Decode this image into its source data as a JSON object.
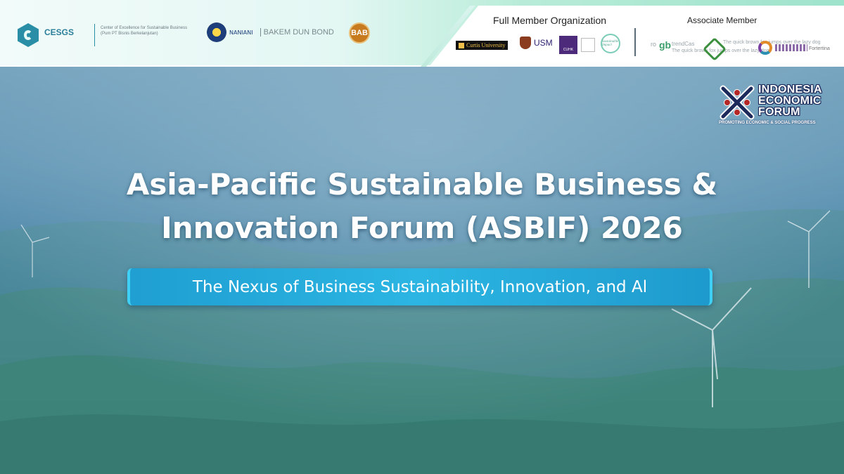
{
  "banner": {
    "cesgs": {
      "name": "CESGS",
      "description": "Center of Excellence for Sustainable Business (Pum PT Bisnis Berkelanjutan)"
    },
    "naniani": {
      "name": "NANIANI"
    },
    "bakem": {
      "name": "BAKEM DUN BOND"
    },
    "bab": {
      "mark": "BAB"
    },
    "full_member_title": "Full Member Organization",
    "associate_member_title": "Associate Member",
    "full_members": {
      "curtis": "Curtis University",
      "usm": "USM",
      "cuhk": "CUHK",
      "sustainable": "Sustainable Impact"
    },
    "associates": {
      "ro": "ro",
      "gb": "gb",
      "trendcas": "trendCas",
      "quick_line_1": "The quick brown fox jumps over the lazy dog",
      "quick_line_2": "The quick brown fox jumps over the lazy dog",
      "fortertina": "Fortertina"
    }
  },
  "ief": {
    "line1": "INDONESIA",
    "line2": "ECONOMIC",
    "line3": "FORUM",
    "tagline": "PROMOTING ECONOMIC & SOCIAL PROGRESS",
    "colors": {
      "x": "#1b2a5a",
      "dots": "#b32727"
    }
  },
  "headline": {
    "line1": "Asia-Pacific Sustainable Business &",
    "line2": "Innovation Forum (ASBIF) 2026",
    "subtitle": "The Nexus of Business Sustainability, Innovation, and Al"
  },
  "colors": {
    "accent": "#2cb5e2",
    "brand_teal": "#2a8fa6"
  }
}
